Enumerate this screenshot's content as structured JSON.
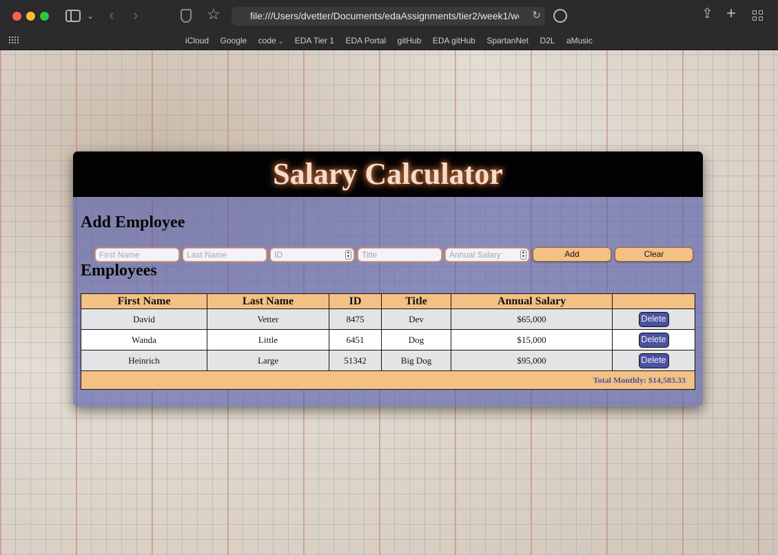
{
  "browser": {
    "url": "file:///Users/dvetter/Documents/edaAssignments/tier2/week1/wee",
    "bookmarks": [
      "iCloud",
      "Google",
      "code",
      "EDA Tier 1",
      "EDA Portal",
      "gitHub",
      "EDA gitHub",
      "SpartanNet",
      "D2L",
      "aMusic"
    ],
    "icons": {
      "star": "☆",
      "back": "‹",
      "forward": "›",
      "chevron_down": "⌄",
      "reload": "↻",
      "share": "⇪",
      "plus": "+",
      "bookmark_caret": "⌄"
    }
  },
  "app": {
    "title": "Salary Calculator",
    "add_heading": "Add Employee",
    "employees_heading": "Employees",
    "form": {
      "first_placeholder": "First Name",
      "last_placeholder": "Last Name",
      "id_placeholder": "ID",
      "title_placeholder": "Title",
      "salary_placeholder": "Annual Salary",
      "add_label": "Add",
      "clear_label": "Clear",
      "spinner_up": "▲",
      "spinner_down": "▼"
    },
    "table": {
      "headers": [
        "First Name",
        "Last Name",
        "ID",
        "Title",
        "Annual Salary",
        ""
      ],
      "rows": [
        {
          "first": "David",
          "last": "Vetter",
          "id": "8475",
          "title": "Dev",
          "salary": "$65,000"
        },
        {
          "first": "Wanda",
          "last": "Little",
          "id": "6451",
          "title": "Dog",
          "salary": "$15,000"
        },
        {
          "first": "Heinrich",
          "last": "Large",
          "id": "51342",
          "title": "Big Dog",
          "salary": "$95,000"
        }
      ],
      "delete_label": "Delete",
      "total": "Total Monthly: $14,583.33"
    }
  },
  "colors": {
    "accent": "#f3c183",
    "delete_button": "#4b51a0",
    "title_glow": "#e07a40"
  }
}
